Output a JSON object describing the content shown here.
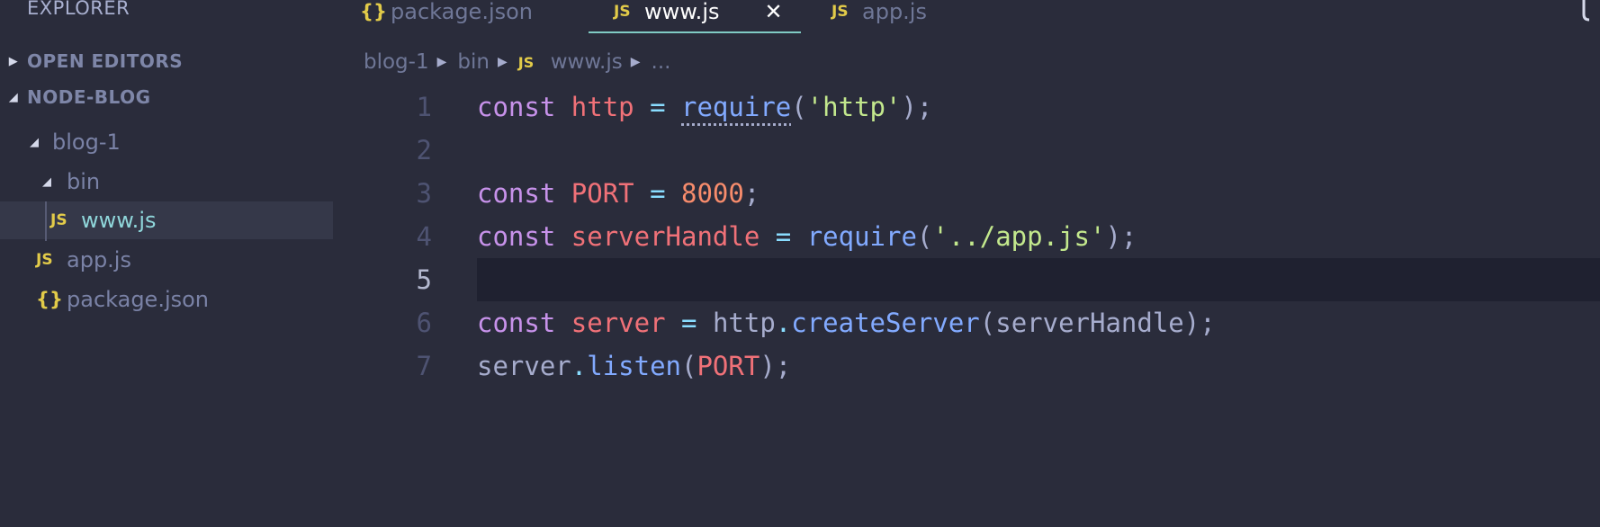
{
  "sidebar": {
    "title": "EXPLORER",
    "sections": [
      {
        "label": "OPEN EDITORS",
        "expanded": false
      },
      {
        "label": "NODE-BLOG",
        "expanded": true
      }
    ],
    "tree": [
      {
        "label": "blog-1",
        "type": "folder"
      },
      {
        "label": "bin",
        "type": "folder"
      },
      {
        "label": "www.js",
        "type": "js-file",
        "icon_text": "JS",
        "selected": true
      },
      {
        "label": "app.js",
        "type": "js-file",
        "icon_text": "JS"
      },
      {
        "label": "package.json",
        "type": "json-file",
        "icon_text": "{}"
      }
    ]
  },
  "tabs": [
    {
      "label": "package.json",
      "icon_text": "{}",
      "active": false
    },
    {
      "label": "www.js",
      "icon_text": "JS",
      "active": true,
      "close": "✕"
    },
    {
      "label": "app.js",
      "icon_text": "JS",
      "active": false
    }
  ],
  "breadcrumb": {
    "items": [
      "blog-1",
      "bin",
      "www.js",
      "..."
    ],
    "js_icon": "JS"
  },
  "editor": {
    "current_line": 5,
    "lines": [
      {
        "num": "1",
        "tokens": [
          {
            "t": "const",
            "k": "kw"
          },
          {
            "t": " ",
            "k": "plain"
          },
          {
            "t": "http",
            "k": "var"
          },
          {
            "t": " = ",
            "k": "op"
          },
          {
            "t": "require",
            "k": "fn"
          },
          {
            "t": "(",
            "k": "punc"
          },
          {
            "t": "'http'",
            "k": "str"
          },
          {
            "t": ");",
            "k": "punc"
          }
        ]
      },
      {
        "num": "2",
        "tokens": []
      },
      {
        "num": "3",
        "tokens": [
          {
            "t": "const",
            "k": "kw"
          },
          {
            "t": " ",
            "k": "plain"
          },
          {
            "t": "PORT",
            "k": "var"
          },
          {
            "t": " = ",
            "k": "op"
          },
          {
            "t": "8000",
            "k": "num"
          },
          {
            "t": ";",
            "k": "punc"
          }
        ]
      },
      {
        "num": "4",
        "tokens": [
          {
            "t": "const",
            "k": "kw"
          },
          {
            "t": " ",
            "k": "plain"
          },
          {
            "t": "serverHandle",
            "k": "var"
          },
          {
            "t": " = ",
            "k": "op"
          },
          {
            "t": "require",
            "k": "fn"
          },
          {
            "t": "(",
            "k": "punc"
          },
          {
            "t": "'../app.js'",
            "k": "str"
          },
          {
            "t": ");",
            "k": "punc"
          }
        ]
      },
      {
        "num": "5",
        "tokens": []
      },
      {
        "num": "6",
        "tokens": [
          {
            "t": "const",
            "k": "kw"
          },
          {
            "t": " ",
            "k": "plain"
          },
          {
            "t": "server",
            "k": "var"
          },
          {
            "t": " = ",
            "k": "op"
          },
          {
            "t": "http",
            "k": "plain"
          },
          {
            "t": ".",
            "k": "op"
          },
          {
            "t": "createServer",
            "k": "fn"
          },
          {
            "t": "(",
            "k": "punc"
          },
          {
            "t": "serverHandle",
            "k": "plain"
          },
          {
            "t": ");",
            "k": "punc"
          }
        ]
      },
      {
        "num": "7",
        "tokens": [
          {
            "t": "server",
            "k": "plain"
          },
          {
            "t": ".",
            "k": "op"
          },
          {
            "t": "listen",
            "k": "fn"
          },
          {
            "t": "(",
            "k": "punc"
          },
          {
            "t": "PORT",
            "k": "var"
          },
          {
            "t": ");",
            "k": "punc"
          }
        ]
      }
    ]
  },
  "colors": {
    "background": "#2a2c3b",
    "active_tab_border": "#80cbc4",
    "js_icon": "#e2cb49",
    "current_line_bg": "#1f2130"
  }
}
